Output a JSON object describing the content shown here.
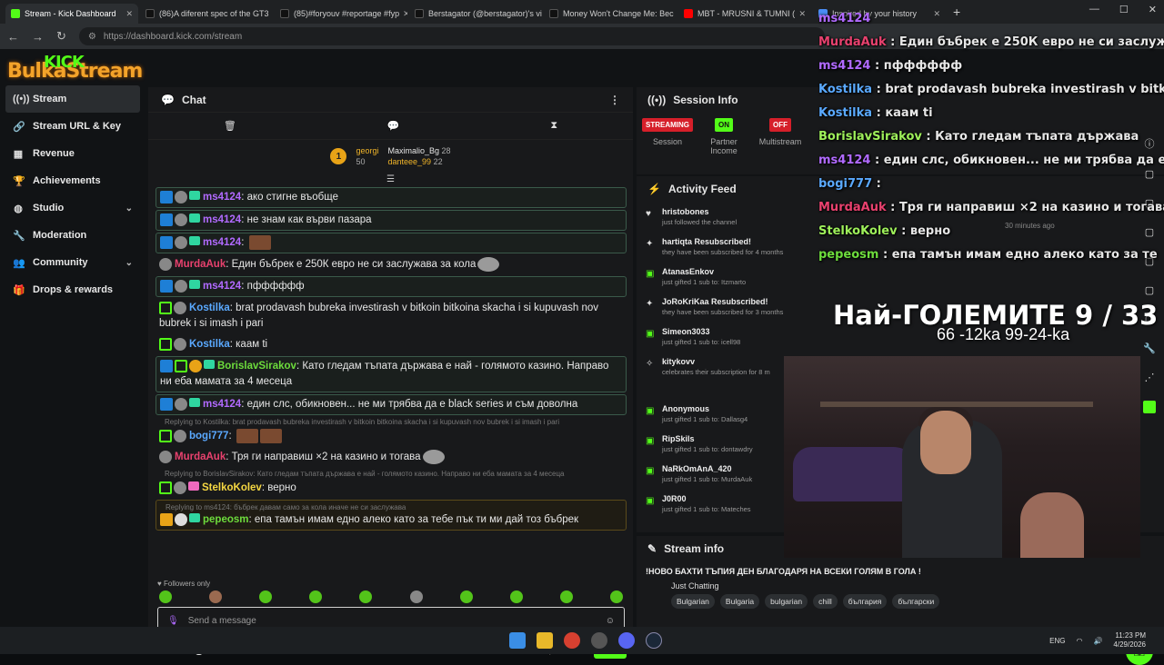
{
  "browser": {
    "tabs": [
      {
        "label": "Stream - Kick Dashboard",
        "color": "#53fc18",
        "active": true
      },
      {
        "label": "(86)A diferent spec of the GT3",
        "color": "#111111"
      },
      {
        "label": "(85)#foryouv #reportage #fyp",
        "color": "#111111"
      },
      {
        "label": "Berstagator (@berstagator)'s vi",
        "color": "#111111"
      },
      {
        "label": "Money Won't Change Me: Bec",
        "color": "#111111"
      },
      {
        "label": "MBT - MRUSNI & TUMNI (",
        "color": "#ff0000"
      },
      {
        "label": "Inspired by your history",
        "color": "#4a8df5"
      }
    ],
    "url": "https://dashboard.kick.com/stream"
  },
  "logo": {
    "text": "BulkaStream",
    "badge": "KICK"
  },
  "sidebar": {
    "items": [
      {
        "label": "Stream",
        "icon": "broadcast-icon",
        "glyph": "((•))"
      },
      {
        "label": "Stream URL & Key",
        "icon": "link-icon",
        "glyph": "🔗"
      },
      {
        "label": "Revenue",
        "icon": "chart-icon",
        "glyph": "▦"
      },
      {
        "label": "Achievements",
        "icon": "trophy-icon",
        "glyph": "🏆"
      },
      {
        "label": "Studio",
        "icon": "globe-icon",
        "glyph": "◍"
      },
      {
        "label": "Moderation",
        "icon": "wrench-icon",
        "glyph": "🔧"
      },
      {
        "label": "Community",
        "icon": "users-icon",
        "glyph": "👥"
      },
      {
        "label": "Drops & rewards",
        "icon": "gift-icon",
        "glyph": "🎁"
      }
    ]
  },
  "chat": {
    "title": "Chat",
    "leaderboard": {
      "first_name": "georgi",
      "first_value": "50",
      "second_name": "Maximalio_Bg",
      "second_value": "28",
      "third_name": "danteee_99",
      "third_value": "22",
      "rank": "1"
    },
    "messages": [
      {
        "user": "ms4124",
        "text": "ако стигне въобще"
      },
      {
        "user": "ms4124",
        "text": "не знам как върви пазара"
      },
      {
        "user": "ms4124",
        "text": ""
      },
      {
        "user": "MurdaAuk",
        "text": "Един бъбрек е 250К евро не си заслужава за кола"
      },
      {
        "user": "ms4124",
        "text": "пфффффф"
      },
      {
        "user": "Kostilka",
        "text": "brat prodavash bubreka investirash v bitkoin bitkoina skacha i si kupuvash nov bubrek i si imash i pari"
      },
      {
        "user": "Kostilka",
        "text": "каам ti"
      },
      {
        "user": "BorislavSirakov",
        "text": "Като гледам тъпата държава е най - голямото казино. Направо ни еба мамата за 4 месеца"
      },
      {
        "user": "ms4124",
        "text": "един слс, обикновен... не ми трябва да е black series и съм доволна"
      },
      {
        "user": "bogi777",
        "text": "",
        "reply": "Replying to Kostilka: brat prodavash bubreka investirash v bitkoin bitkoina skacha i si kupuvash nov bubrek i si imash i pari"
      },
      {
        "user": "MurdaAuk",
        "text": "Тря ги направиш ×2 на казино и тогава"
      },
      {
        "user": "StelkoKolev",
        "text": "верно",
        "reply": "Replying to BorislavSirakov: Като гледам тъпата държава е най - голямото казино. Направо ни еба мамата за 4 месеца"
      },
      {
        "user": "pepeosm",
        "text": "епа тамън имам едно алеко като за тебе пък ти ми дай тоз бъбрек",
        "reply": "Replying to ms4124: бъбрек давам само за кола иначе не си заслужава"
      }
    ],
    "followers_only": "Followers only",
    "input_placeholder": "Send a message",
    "footer_count": "0",
    "send_label": "Chat"
  },
  "session": {
    "title": "Session Info",
    "statuses": [
      {
        "pill": "STREAMING",
        "label": "Session",
        "kind": "red"
      },
      {
        "pill": "ON",
        "label": "Partner Income",
        "kind": "green"
      },
      {
        "pill": "OFF",
        "label": "Multistream",
        "kind": "red"
      }
    ]
  },
  "activity": {
    "title": "Activity Feed",
    "items": [
      {
        "name": "hristobones",
        "desc": "just followed the channel",
        "ago": ""
      },
      {
        "name": "hartiqta Resubscribed!",
        "desc": "they have been subscribed for 4 months",
        "ago": ""
      },
      {
        "name": "AtanasEnkov",
        "desc": "just gifted 1 sub to: Itzmarto",
        "ago": "1 hour ago"
      },
      {
        "name": "JoRoKriKaa Resubscribed!",
        "desc": "they have been subscribed for 3 months",
        "ago": ""
      },
      {
        "name": "Simeon3033",
        "desc": "just gifted 1 sub to: icell98",
        "ago": "1 hour ago"
      },
      {
        "name": "kitykovv",
        "desc": "celebrates their subscription for 8 m",
        "ago": ""
      },
      {
        "name": "Anonymous",
        "desc": "just gifted 1 sub to: Dallasg4",
        "ago": ""
      },
      {
        "name": "RipSkils",
        "desc": "just gifted 1 sub to: dontawdry",
        "ago": ""
      },
      {
        "name": "NaRkOmAnA_420",
        "desc": "just gifted 1 sub to: MurdaAuk",
        "ago": ""
      },
      {
        "name": "J0R00",
        "desc": "just gifted 1 sub to: Mateches",
        "ago": ""
      }
    ],
    "ago_right": "30 minutes ago"
  },
  "stream_info": {
    "title": "Stream info",
    "stream_title": "!НОВО БАХТИ ТЪПИЯ ДЕН БЛАГОДАРЯ НА ВСЕКИ ГОЛЯМ В ГОЛА !",
    "category": "Just Chatting",
    "tags": [
      "Bulgarian",
      "Bulgaria",
      "bulgarian",
      "chill",
      "българия",
      "български"
    ]
  },
  "overlay": {
    "chat": [
      {
        "user": "ms4124",
        "text": "",
        "color": "c-purple"
      },
      {
        "user": "MurdaAuk",
        "text": "Един бъбрек е 250К евро не си заслужава",
        "color": "c-red"
      },
      {
        "user": "ms4124",
        "text": "пфффффф",
        "color": "c-purple"
      },
      {
        "user": "Kostilka",
        "text": "brat prodavash bubreka investirash v bitkoin",
        "color": "c-blue"
      },
      {
        "user": "Kostilka",
        "text": "каам ti",
        "color": "c-blue"
      },
      {
        "user": "BorislavSirakov",
        "text": "Като гледам тъпата държава",
        "color": "c-lime"
      },
      {
        "user": "ms4124",
        "text": "един слс, обикновен... не ми трябва да е",
        "color": "c-purple"
      },
      {
        "user": "bogi777",
        "text": "",
        "color": "c-blue"
      },
      {
        "user": "MurdaAuk",
        "text": "Тря ги направиш ×2 на казино и тогава",
        "color": "c-red"
      },
      {
        "user": "StelkoKolev",
        "text": "верно",
        "color": "c-lime"
      },
      {
        "user": "pepeosm",
        "text": "епа тамън имам едно алеко като за те",
        "color": "c-green"
      }
    ],
    "title": "Най-ГОЛЕМИТЕ 9 / 33",
    "subtitle": "66 -12ka 99-24-ka"
  },
  "taskbar": {
    "lang": "ENG",
    "time": "11:23 PM",
    "date": "4/29/2026"
  }
}
